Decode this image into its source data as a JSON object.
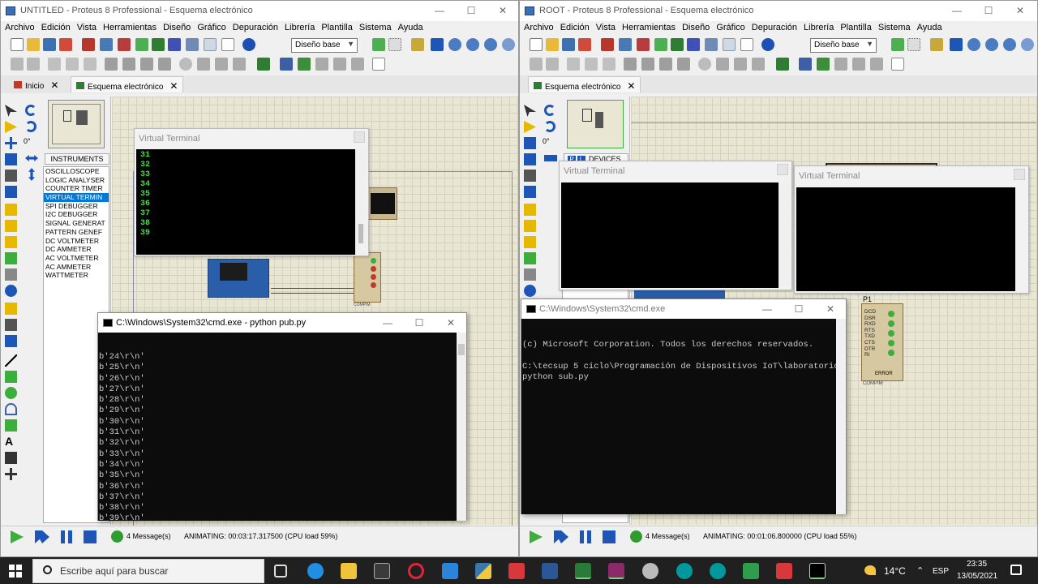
{
  "left_window": {
    "title": "UNTITLED - Proteus 8 Professional - Esquema electrónico",
    "menu": [
      "Archivo",
      "Edición",
      "Vista",
      "Herramientas",
      "Diseño",
      "Gráfico",
      "Depuración",
      "Librería",
      "Plantilla",
      "Sistema",
      "Ayuda"
    ],
    "design_combo": "Diseño base",
    "tabs": [
      {
        "label": "Inicio"
      },
      {
        "label": "Esquema electrónico"
      }
    ],
    "rotation": "0°",
    "instruments_header": "INSTRUMENTS",
    "instruments": [
      "OSCILLOSCOPE",
      "LOGIC ANALYSER",
      "COUNTER TIMER",
      "VIRTUAL TERMIN",
      "SPI DEBUGGER",
      "I2C DEBUGGER",
      "SIGNAL GENERAT",
      "PATTERN GENEF",
      "DC VOLTMETER",
      "DC AMMETER",
      "AC VOLTMETER",
      "AC AMMETER",
      "WATTMETER"
    ],
    "selected_instrument": 3,
    "virtual_terminal": {
      "title": "Virtual Terminal",
      "lines": [
        "31",
        "32",
        "33",
        "34",
        "35",
        "36",
        "37",
        "38",
        "39"
      ]
    },
    "compim_label": "COMPIM",
    "status": {
      "messages": "4 Message(s)",
      "animating": "ANIMATING: 00:03:17.317500 (CPU load 59%)"
    }
  },
  "right_window": {
    "title": "ROOT - Proteus 8 Professional - Esquema electrónico",
    "menu": [
      "Archivo",
      "Edición",
      "Vista",
      "Herramientas",
      "Diseño",
      "Gráfico",
      "Depuración",
      "Librería",
      "Plantilla",
      "Sistema",
      "Ayuda"
    ],
    "design_combo": "Diseño base",
    "tabs": [
      {
        "label": "Esquema electrónico"
      }
    ],
    "rotation": "0°",
    "devices_header": "DEVICES",
    "vt1_title": "Virtual Terminal",
    "vt2_title": "Virtual Terminal",
    "p1_label": "P1",
    "pins": [
      "DCD",
      "DSR",
      "RXD",
      "RTS",
      "TXD",
      "CTS",
      "DTR",
      "RI"
    ],
    "error_label": "ERROR",
    "compim_label": "COMPIM",
    "status": {
      "messages": "4 Message(s)",
      "animating": "ANIMATING: 00:01:06.800000 (CPU load 55%)"
    }
  },
  "cmd_left": {
    "title": "C:\\Windows\\System32\\cmd.exe - python  pub.py",
    "lines": [
      "b'24\\r\\n'",
      "b'25\\r\\n'",
      "b'26\\r\\n'",
      "b'27\\r\\n'",
      "b'28\\r\\n'",
      "b'29\\r\\n'",
      "b'30\\r\\n'",
      "b'31\\r\\n'",
      "b'32\\r\\n'",
      "b'33\\r\\n'",
      "b'34\\r\\n'",
      "b'35\\r\\n'",
      "b'36\\r\\n'",
      "b'37\\r\\n'",
      "b'38\\r\\n'",
      "b'39\\r\\n'"
    ]
  },
  "cmd_right": {
    "title": "C:\\Windows\\System32\\cmd.exe",
    "lines": [
      "(c) Microsoft Corporation. Todos los derechos reservados.",
      "",
      "C:\\tecsup 5 ciclo\\Programación de Dispositivos IoT\\laboratorios>",
      "python sub.py"
    ]
  },
  "taskbar": {
    "search_placeholder": "Escribe aquí para buscar",
    "weather": "14°C",
    "lang": "ESP",
    "time": "23:35",
    "date": "13/05/2021"
  },
  "colors": {
    "terminal_text": "#38e838",
    "cmd_bg": "#0c0c0c",
    "canvas": "#e9e7d4",
    "selection": "#0078d7"
  }
}
